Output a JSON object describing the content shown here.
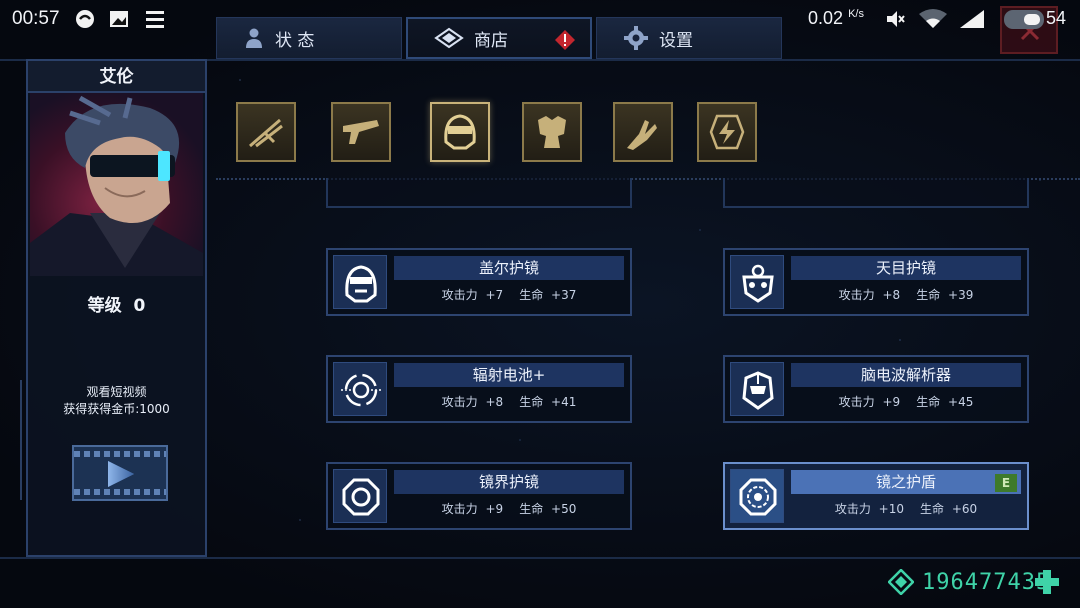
{
  "status_bar": {
    "time": "00:57",
    "net_speed": "0.02",
    "net_unit": "K/s",
    "battery": "54"
  },
  "tabs": [
    {
      "label": "状 态",
      "icon": "person-icon"
    },
    {
      "label": "商店",
      "icon": "diamond-icon",
      "alert": true
    },
    {
      "label": "设置",
      "icon": "gear-icon"
    }
  ],
  "character": {
    "name": "艾伦",
    "level_label": "等级",
    "level_value": "0"
  },
  "video_reward": {
    "line1": "观看短视频",
    "line2": "获得获得金币:1000"
  },
  "categories": [
    {
      "name": "sword-icon"
    },
    {
      "name": "gun-icon"
    },
    {
      "name": "helmet-icon",
      "active": true
    },
    {
      "name": "armor-icon"
    },
    {
      "name": "claw-icon"
    },
    {
      "name": "energy-icon"
    }
  ],
  "items": [
    {
      "name": "盖尔护镜",
      "atk_label": "攻击力",
      "atk": "+7",
      "hp_label": "生命",
      "hp": "+37",
      "icon": "helmet-icon"
    },
    {
      "name": "天目护镜",
      "atk_label": "攻击力",
      "atk": "+8",
      "hp_label": "生命",
      "hp": "+39",
      "icon": "mask-icon"
    },
    {
      "name": "辐射电池+",
      "atk_label": "攻击力",
      "atk": "+8",
      "hp_label": "生命",
      "hp": "+41",
      "icon": "target-icon"
    },
    {
      "name": "脑电波解析器",
      "atk_label": "攻击力",
      "atk": "+9",
      "hp_label": "生命",
      "hp": "+45",
      "icon": "robot-head-icon"
    },
    {
      "name": "镜界护镜",
      "atk_label": "攻击力",
      "atk": "+9",
      "hp_label": "生命",
      "hp": "+50",
      "icon": "octagon-icon"
    },
    {
      "name": "镜之护盾",
      "atk_label": "攻击力",
      "atk": "+10",
      "hp_label": "生命",
      "hp": "+60",
      "icon": "shield-lens-icon",
      "equipped": true,
      "badge": "E"
    }
  ],
  "currency": {
    "value": "196477435",
    "icon": "gem-icon"
  },
  "colors": {
    "accent": "#3fd3a8",
    "frame": "#2d4470",
    "gold": "#c9b37a"
  }
}
